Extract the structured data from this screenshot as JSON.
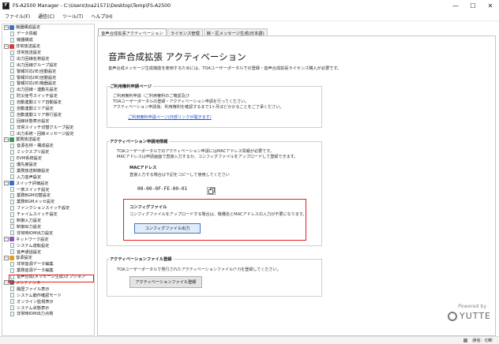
{
  "window": {
    "title": "FS-A2500 Manager - C:\\Users\\toa21571\\Desktop\\Temp\\FS-A2500",
    "app_icon_glyph": "F",
    "buttons": {
      "minimize": "—",
      "maximize": "☐",
      "close": "✕"
    }
  },
  "menu": [
    "ファイル(F)",
    "通信(C)",
    "ツール(T)",
    "ヘルプ(H)"
  ],
  "tree": [
    {
      "type": "cat",
      "label": "機器構成設定",
      "color": "#3a6fc4",
      "expanded": "−"
    },
    {
      "type": "child",
      "label": "データ情報"
    },
    {
      "type": "child",
      "label": "機器構成"
    },
    {
      "type": "cat",
      "label": "非常放送設定",
      "color": "#d04040",
      "expanded": "−"
    },
    {
      "type": "child",
      "label": "非常放送設定"
    },
    {
      "type": "child",
      "label": "出力回線名称設定"
    },
    {
      "type": "child",
      "label": "出力回線グループ設定"
    },
    {
      "type": "child",
      "label": "警報対応(IE)自動設定"
    },
    {
      "type": "child",
      "label": "警報対応(IE)自動設定"
    },
    {
      "type": "child",
      "label": "警報対応(IE)機器設定"
    },
    {
      "type": "child",
      "label": "出力回線・連動先設定"
    },
    {
      "type": "child",
      "label": "防災信号スイッチ設定"
    },
    {
      "type": "child",
      "label": "自動連動エリア自動設定"
    },
    {
      "type": "child",
      "label": "自動連動エリア設定"
    },
    {
      "type": "child",
      "label": "自動連動エリア移行設定"
    },
    {
      "type": "child",
      "label": "回線状態表示設定"
    },
    {
      "type": "child",
      "label": "非常スイッチ切替グループ設定"
    },
    {
      "type": "child",
      "label": "出力系統・回線メッセージ設定"
    },
    {
      "type": "cat",
      "label": "業務放送設定",
      "color": "#2f9e4c",
      "expanded": "−"
    },
    {
      "type": "child",
      "label": "音源名称・構成設定"
    },
    {
      "type": "child",
      "label": "ミックスプリ設定"
    },
    {
      "type": "child",
      "label": "EVM系統設定"
    },
    {
      "type": "child",
      "label": "優先度設定"
    },
    {
      "type": "child",
      "label": "業務放送制御設定"
    },
    {
      "type": "child",
      "label": "入力音声設定"
    },
    {
      "type": "cat",
      "label": "スイッチ評価設定",
      "color": "#3a6fc4",
      "expanded": "−"
    },
    {
      "type": "child",
      "label": "一斉スイッチ設定"
    },
    {
      "type": "child",
      "label": "業務BGM切替設定"
    },
    {
      "type": "child",
      "label": "業務BGMメッセ設定"
    },
    {
      "type": "child",
      "label": "ファンクションスイッチ設定"
    },
    {
      "type": "child",
      "label": "チャイムスイッチ設定"
    },
    {
      "type": "child",
      "label": "制御入力設定"
    },
    {
      "type": "child",
      "label": "制御出力設定"
    },
    {
      "type": "child",
      "label": "非常時IDM出力設定"
    },
    {
      "type": "cat",
      "label": "ネットワーク設定",
      "color": "#8a55c8",
      "expanded": "−"
    },
    {
      "type": "child",
      "label": "システム運転設定"
    },
    {
      "type": "child",
      "label": "音声通話設定"
    },
    {
      "type": "cat",
      "label": "音源設定",
      "color": "#e0a020",
      "expanded": "−"
    },
    {
      "type": "child",
      "label": "非常音源データ編集"
    },
    {
      "type": "child",
      "label": "業務音源データ編集"
    },
    {
      "type": "child",
      "label": "音声合成(メッセージ生成)オプション"
    },
    {
      "type": "cat",
      "label": "メンテナンス",
      "color": "#6a6a6a",
      "expanded": "−"
    },
    {
      "type": "child",
      "label": "履歴ファイル表示"
    },
    {
      "type": "child",
      "label": "システム動作確認モード"
    },
    {
      "type": "child",
      "label": "オンライン監視表示"
    },
    {
      "type": "child",
      "label": "システム状態表示"
    },
    {
      "type": "child",
      "label": "非常時IDM出力点検"
    }
  ],
  "tabs": [
    "音声合成拡張アクティベーション",
    "ライセンス管理",
    "館・区メッセージ生成(日本語)"
  ],
  "page": {
    "title": "音声合成拡張 アクティベーション",
    "subtitle": "音声合成メッセージ生成機能を使用するためには、TOAユーザーポータルでの登録・音声合成拡張ライセンス購入が必要です。",
    "section1": {
      "label": "ご利用権利申請ページ",
      "lines": [
        "ご利用権利申請（ご利用権利のご確認及び",
        "TOAユーザーポータルの登録・アクティベーション申請を行ってください。",
        "アクティベーション申請後、利用権利を確認するまで1ヶ月ほどかかることをご了承ください。"
      ],
      "link": "ご利用権利申請ページ(外部リンクが開きます)"
    },
    "section2": {
      "label": "アクティベーション申請用情報",
      "lines": [
        "TOAユーザーポータルでのアクティベーション申請にはMACアドレス情報が必要です。",
        "MACアドレスは申請画面で直接入力するか、コンフィグファイルをアップロードして登録できます。"
      ],
      "mac_label": "MACアドレス",
      "mac_hint": "直接入力する場合は下記をコピーして使用してください",
      "mac_value": "00-00-0F-FE-00-01",
      "config_label": "コンフィグファイル",
      "config_text": "コンフィグファイルをアップロードする場合は、機種名とMACアドレスの入力が不要になります。",
      "config_button": "コンフィグファイル出力"
    },
    "section3": {
      "label": "アクティベーションファイル登録",
      "text": "TOAユーザーポータルで発行されたアクティベーションファイル(*.f)を登録してください。",
      "button": "アクティベーションファイル登録"
    }
  },
  "brand": {
    "powered_by": "Powered by",
    "name": "YUTTE"
  },
  "status": {
    "text": "通信：切断"
  },
  "colors": {
    "highlight": "#e02020",
    "link": "#1a4fd6",
    "primary_border": "#3b74c7"
  }
}
